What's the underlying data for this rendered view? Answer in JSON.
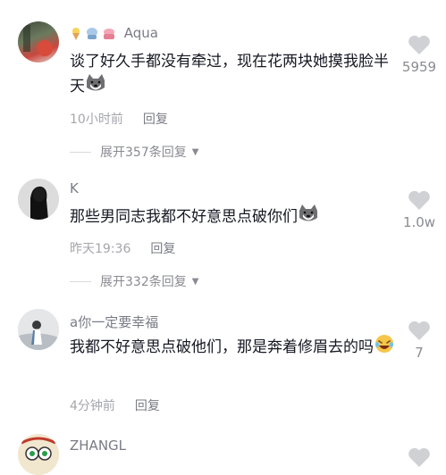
{
  "comments": [
    {
      "username": "Aqua",
      "text": "谈了好久手都没有牵过，现在花两块她摸我脸半天",
      "time": "10小时前",
      "reply_label": "回复",
      "likes": "5959",
      "expand_label": "展开357条回复",
      "has_badges": true,
      "emoji": "doge"
    },
    {
      "username": "K",
      "text": "那些男同志我都不好意思点破你们",
      "time": "昨天19:36",
      "reply_label": "回复",
      "likes": "1.0w",
      "expand_label": "展开332条回复",
      "emoji": "doge"
    },
    {
      "username": "a你一定要幸福",
      "text": "我都不好意思点破他们，那是奔着修眉去的吗",
      "time": "4分钟前",
      "reply_label": "回复",
      "likes": "7",
      "emoji": "laugh"
    },
    {
      "username": "ZHANGL",
      "text": "",
      "likes": ""
    }
  ],
  "colors": {
    "text": "#161823",
    "username": "#7a7c85",
    "meta": "#a5a6ad",
    "heart": "#d0d1d5"
  },
  "icons": {
    "like": "heart-icon",
    "expand": "triangle-down-icon",
    "doge": "doge-emoji-icon",
    "laugh": "laughing-emoji-icon"
  }
}
